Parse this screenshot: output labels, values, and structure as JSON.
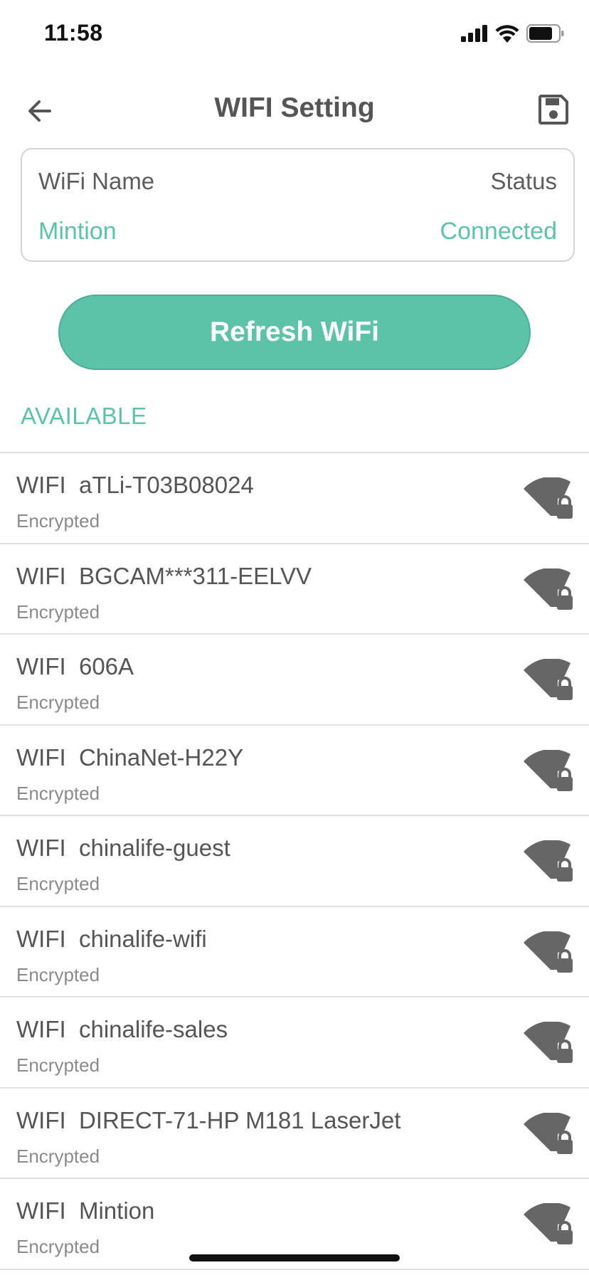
{
  "status_bar": {
    "time": "11:58",
    "icons": [
      "cellular-signal-icon",
      "wifi-icon",
      "battery-icon"
    ]
  },
  "nav": {
    "title": "WIFI Setting",
    "back_icon": "arrow-left-icon",
    "save_icon": "floppy-disk-icon"
  },
  "current": {
    "name_label": "WiFi Name",
    "status_label": "Status",
    "name_value": "Mintion",
    "status_value": "Connected"
  },
  "refresh_label": "Refresh WiFi",
  "section_title": "AVAILABLE",
  "networks": [
    {
      "name": "WIFI  aTLi-T03B08024",
      "status": "Encrypted"
    },
    {
      "name": "WIFI  BGCAM***311-EELVV",
      "status": "Encrypted"
    },
    {
      "name": "WIFI  606A",
      "status": "Encrypted"
    },
    {
      "name": "WIFI  ChinaNet-H22Y",
      "status": "Encrypted"
    },
    {
      "name": "WIFI  chinalife-guest",
      "status": "Encrypted"
    },
    {
      "name": "WIFI  chinalife-wifi",
      "status": "Encrypted"
    },
    {
      "name": "WIFI  chinalife-sales",
      "status": "Encrypted"
    },
    {
      "name": "WIFI  DIRECT-71-HP M181 LaserJet",
      "status": "Encrypted"
    },
    {
      "name": "WIFI  Mintion",
      "status": "Encrypted"
    }
  ],
  "colors": {
    "accent": "#5cc3a8",
    "text": "#555555",
    "subtext": "#8a8a8a",
    "icon": "#666666"
  }
}
